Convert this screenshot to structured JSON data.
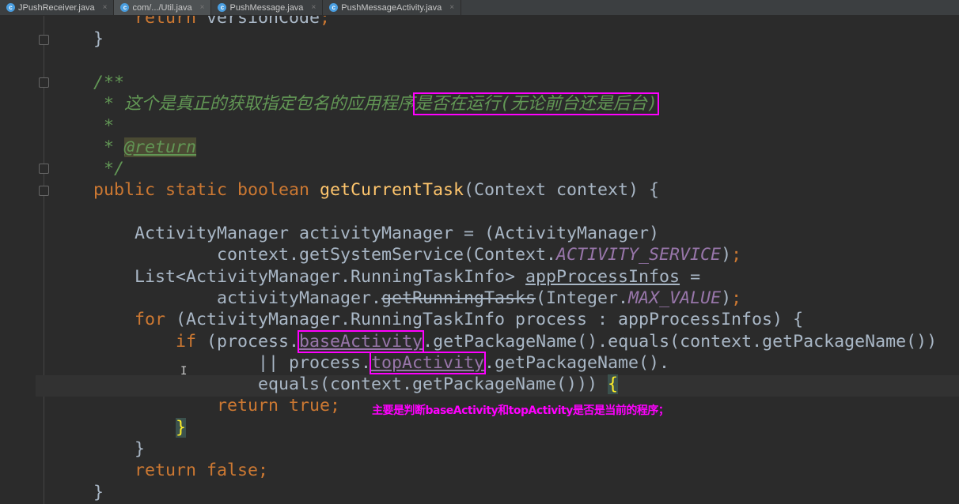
{
  "tabs": [
    {
      "label": "JPushReceiver.java",
      "active": false
    },
    {
      "label": "com/.../Util.java",
      "active": true
    },
    {
      "label": "PushMessage.java",
      "active": false
    },
    {
      "label": "PushMessageActivity.java",
      "active": false
    }
  ],
  "code": [
    {
      "row": 0,
      "indent": 8,
      "tokens": [
        [
          "return ",
          "kw"
        ],
        [
          "versionCode",
          ""
        ],
        [
          ";",
          "kw"
        ]
      ]
    },
    {
      "row": 1,
      "indent": 4,
      "tokens": [
        [
          "}",
          ""
        ]
      ]
    },
    {
      "row": 3,
      "indent": 4,
      "tokens": [
        [
          "/**",
          "cm"
        ]
      ]
    },
    {
      "row": 4,
      "indent": 5,
      "tokens": [
        [
          "* 这个是真正的获取指定包名的应用程序",
          "cm"
        ],
        [
          "是否在运行(无论前台还是后台)",
          "cm boxed"
        ]
      ]
    },
    {
      "row": 5,
      "indent": 5,
      "tokens": [
        [
          "*",
          "cm"
        ]
      ]
    },
    {
      "row": 6,
      "indent": 5,
      "tokens": [
        [
          "* ",
          "cm"
        ],
        [
          "@return",
          "tag"
        ]
      ]
    },
    {
      "row": 7,
      "indent": 5,
      "tokens": [
        [
          "*/",
          "cm"
        ]
      ]
    },
    {
      "row": 8,
      "indent": 4,
      "tokens": [
        [
          "public static boolean ",
          "kw"
        ],
        [
          "getCurrentTask",
          "fn"
        ],
        [
          "(Context context) {",
          ""
        ]
      ]
    },
    {
      "row": 10,
      "indent": 8,
      "tokens": [
        [
          "ActivityManager activityManager = (ActivityManager)",
          ""
        ]
      ]
    },
    {
      "row": 11,
      "indent": 16,
      "tokens": [
        [
          "context.getSystemService(Context.",
          ""
        ],
        [
          "ACTIVITY_SERVICE",
          "const"
        ],
        [
          ")",
          ""
        ],
        [
          ";",
          "kw"
        ]
      ]
    },
    {
      "row": 12,
      "indent": 8,
      "tokens": [
        [
          "List<ActivityManager.RunningTaskInfo> ",
          ""
        ],
        [
          "appProcessInfos",
          "ul"
        ],
        [
          " =",
          ""
        ]
      ]
    },
    {
      "row": 13,
      "indent": 16,
      "tokens": [
        [
          "activityManager.",
          ""
        ],
        [
          "getRunningTasks",
          "strike"
        ],
        [
          "(Integer.",
          ""
        ],
        [
          "MAX_VALUE",
          "const"
        ],
        [
          ")",
          ""
        ],
        [
          ";",
          "kw"
        ]
      ]
    },
    {
      "row": 14,
      "indent": 8,
      "tokens": [
        [
          "for ",
          "kw"
        ],
        [
          "(ActivityManager.RunningTaskInfo process : appProcessInfos) {",
          ""
        ]
      ]
    },
    {
      "row": 15,
      "indent": 12,
      "tokens": [
        [
          "if ",
          "kw"
        ],
        [
          "(process.",
          ""
        ],
        [
          "baseActivity",
          "fld boxed"
        ],
        [
          ".getPackageName().equals(context.getPackageName())",
          ""
        ]
      ]
    },
    {
      "row": 16,
      "indent": 20,
      "tokens": [
        [
          "|| process.",
          ""
        ],
        [
          "topActivity",
          "fld boxed"
        ],
        [
          ".getPackageName().",
          ""
        ]
      ]
    },
    {
      "row": 17,
      "indent": 20,
      "tokens": [
        [
          "equals(context.getPackageName())) ",
          ""
        ],
        [
          "{",
          "brace"
        ]
      ]
    },
    {
      "row": 18,
      "indent": 16,
      "tokens": [
        [
          "return true",
          "kw"
        ],
        [
          ";",
          "kw"
        ]
      ]
    },
    {
      "row": 19,
      "indent": 12,
      "tokens": [
        [
          "}",
          "brace"
        ]
      ]
    },
    {
      "row": 20,
      "indent": 8,
      "tokens": [
        [
          "}",
          ""
        ]
      ]
    },
    {
      "row": 21,
      "indent": 8,
      "tokens": [
        [
          "return false",
          "kw"
        ],
        [
          ";",
          "kw"
        ]
      ]
    },
    {
      "row": 22,
      "indent": 4,
      "tokens": [
        [
          "}",
          ""
        ]
      ]
    }
  ],
  "annotation": "主要是判断baseActivity和topActivity是否是当前的程序；",
  "colors": {
    "keyword": "#cc7832",
    "comment": "#629755",
    "method": "#ffc66d",
    "constant": "#9876aa",
    "highlight": "#ff00ff"
  }
}
